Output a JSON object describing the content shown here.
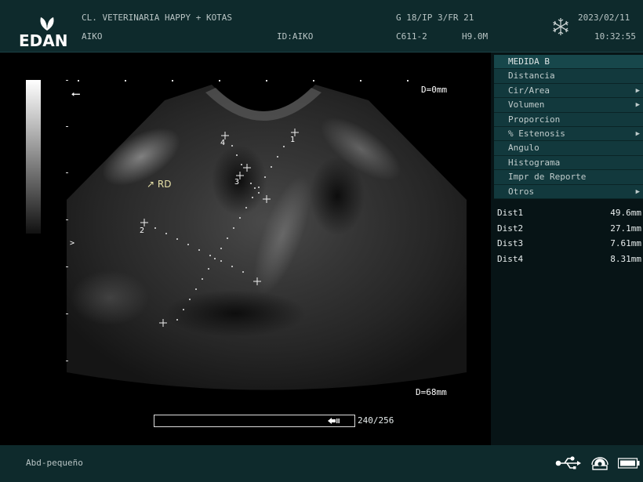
{
  "header": {
    "brand": "EDAN",
    "clinic": "CL. VETERINARIA HAPPY + KOTAS",
    "patient": "AIKO",
    "patient_id": "ID:AIKO",
    "params": "G 18/IP 3/FR 21",
    "probe": "C611-2",
    "frequency": "H9.0M",
    "date": "2023/02/11",
    "time": "10:32:55",
    "freeze_icon": "snowflake-icon"
  },
  "image": {
    "depth_top": "D=0mm",
    "depth_bottom": "D=68mm",
    "annotation": "RD",
    "marker_labels": [
      "1",
      "2",
      "3",
      "4"
    ],
    "cine_count": "240/256",
    "cine_position": 0.9375
  },
  "menu": {
    "items": [
      {
        "label": "MEDIDA B",
        "arrow": ""
      },
      {
        "label": "Distancia",
        "arrow": ""
      },
      {
        "label": "Cir/Area",
        "arrow": "▶"
      },
      {
        "label": "Volumen",
        "arrow": "▶"
      },
      {
        "label": "Proporcion",
        "arrow": ""
      },
      {
        "label": "% Estenosis",
        "arrow": "▶"
      },
      {
        "label": "Angulo",
        "arrow": ""
      },
      {
        "label": "Histograma",
        "arrow": ""
      },
      {
        "label": "Impr de Reporte",
        "arrow": ""
      },
      {
        "label": "Otros",
        "arrow": "▶"
      }
    ]
  },
  "results": [
    {
      "label": "Dist1",
      "value": "49.6mm"
    },
    {
      "label": "Dist2",
      "value": "27.1mm"
    },
    {
      "label": "Dist3",
      "value": "7.61mm"
    },
    {
      "label": "Dist4",
      "value": "8.31mm"
    }
  ],
  "footer": {
    "preset": "Abd-pequeño",
    "icons": [
      "usb-icon",
      "printer-icon",
      "battery-icon"
    ]
  }
}
